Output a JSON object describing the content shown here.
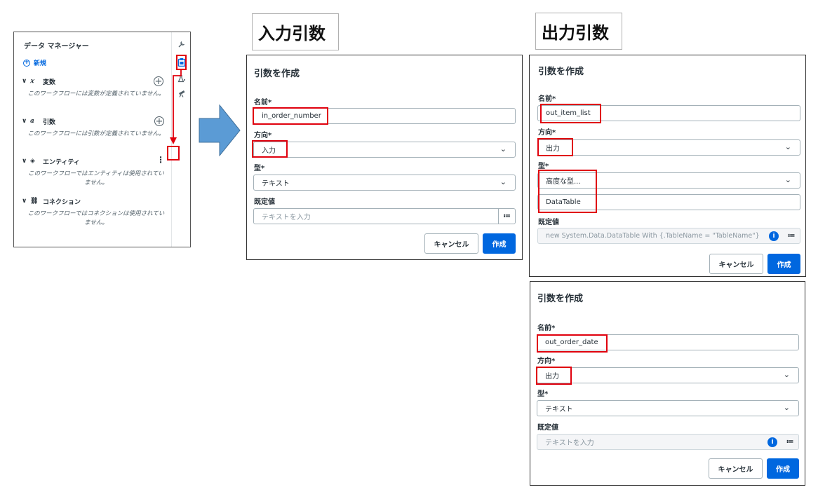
{
  "data_manager": {
    "title": "データ マネージャー",
    "new_label": "新規",
    "sections": [
      {
        "icon_glyph": "𝑥",
        "label": "変数",
        "empty_text": "このワークフローには変数が定義されていません。"
      },
      {
        "icon_glyph": "a",
        "label": "引数",
        "empty_text": "このワークフローには引数が定義されていません。"
      },
      {
        "icon_glyph": "◈",
        "label": "エンティティ",
        "empty_text": "このワークフローではエンティティは使用されていません。"
      },
      {
        "icon_glyph": "⛓",
        "label": "コネクション",
        "empty_text": "このワークフローではコネクションは使用されていません。"
      }
    ],
    "rail_icons": [
      "wrench-icon",
      "clipboard-icon",
      "flask-icon",
      "telescope-icon"
    ]
  },
  "labels": {
    "input_args": "入力引数",
    "output_args": "出力引数"
  },
  "common": {
    "dialog_title": "引数を作成",
    "name_label": "名前*",
    "direction_label": "方向*",
    "type_label": "型*",
    "default_label": "既定値",
    "cancel": "キャンセル",
    "create": "作成",
    "default_placeholder": "テキストを入力",
    "adv_glyph": "≔",
    "info_glyph": "i",
    "caret_glyph": "⌄"
  },
  "dialog_input": {
    "name_value": "in_order_number",
    "direction_value": "入力",
    "type_value": "テキスト"
  },
  "dialog_output_1": {
    "name_value": "out_item_list",
    "direction_value": "出力",
    "type_value": "高度な型...",
    "type_sub_value": "DataTable",
    "default_value": "new System.Data.DataTable With {.TableName = \"TableName\"}"
  },
  "dialog_output_2": {
    "name_value": "out_order_date",
    "direction_value": "出力",
    "type_value": "テキスト"
  },
  "colors": {
    "accent": "#0067df",
    "highlight": "#e0000d",
    "arrow": "#5b9bd5"
  }
}
